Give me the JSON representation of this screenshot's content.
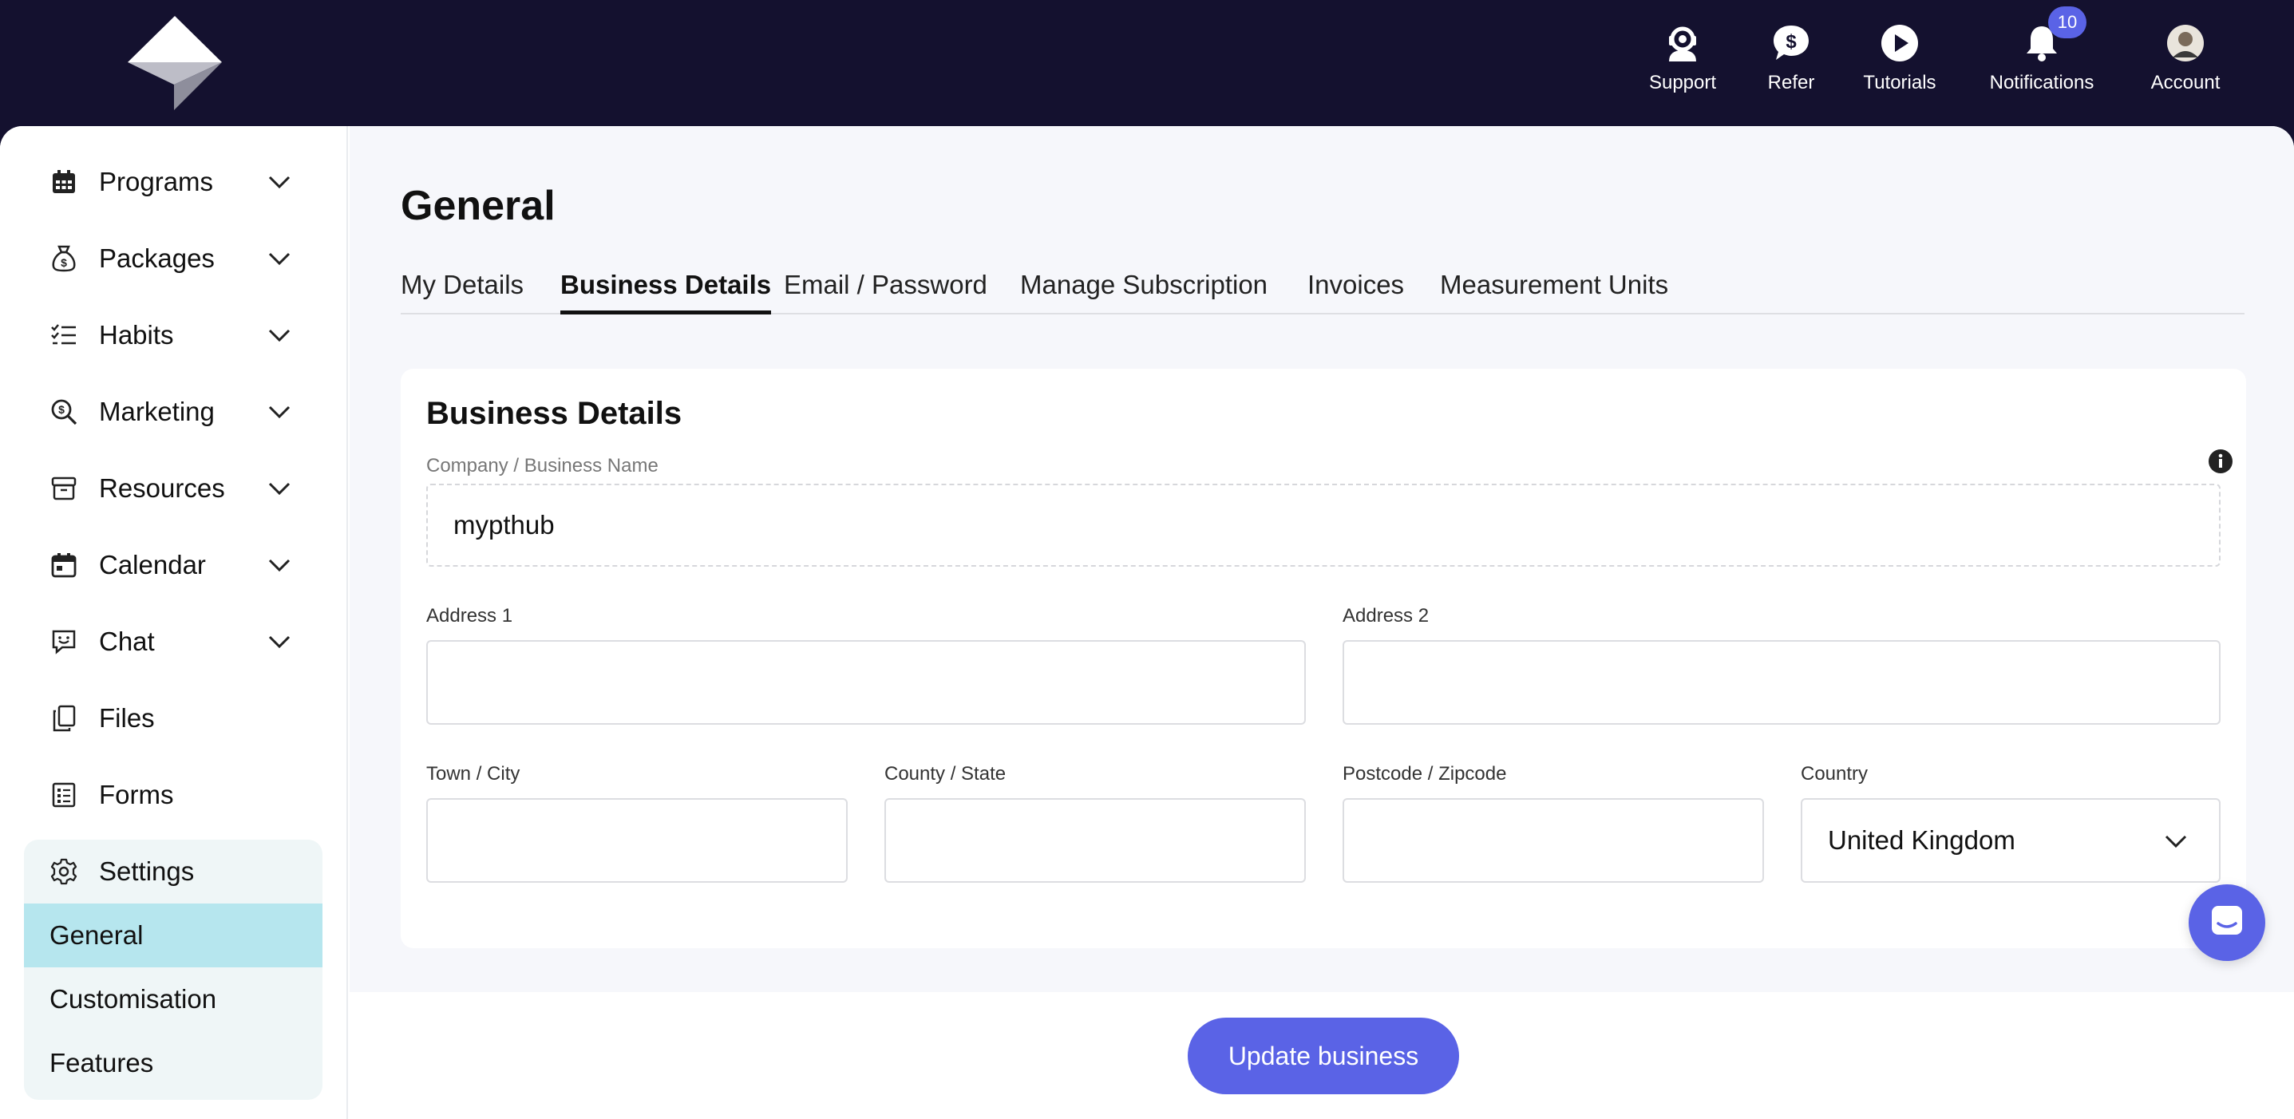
{
  "brand": {
    "logo_icon": "paper-plane-logo"
  },
  "topnav": [
    {
      "label": "Support",
      "icon": "headset-icon"
    },
    {
      "label": "Refer",
      "icon": "dollar-bubble-icon"
    },
    {
      "label": "Tutorials",
      "icon": "play-icon"
    },
    {
      "label": "Notifications",
      "icon": "bell-icon",
      "badge": "10"
    },
    {
      "label": "Account",
      "icon": "avatar"
    }
  ],
  "sidebar": {
    "items": [
      {
        "label": "Programs",
        "icon": "calendar-grid-icon"
      },
      {
        "label": "Packages",
        "icon": "money-bag-icon"
      },
      {
        "label": "Habits",
        "icon": "checklist-icon"
      },
      {
        "label": "Marketing",
        "icon": "search-dollar-icon"
      },
      {
        "label": "Resources",
        "icon": "archive-box-icon"
      },
      {
        "label": "Calendar",
        "icon": "calendar-icon"
      },
      {
        "label": "Chat",
        "icon": "chat-icon"
      },
      {
        "label": "Files",
        "icon": "files-icon"
      },
      {
        "label": "Forms",
        "icon": "form-icon"
      }
    ],
    "settings": {
      "label": "Settings",
      "icon": "gear-icon",
      "sub_items": [
        "General",
        "Customisation",
        "Features"
      ],
      "active": "General"
    }
  },
  "page": {
    "title": "General",
    "tabs": [
      "My Details",
      "Business Details",
      "Email / Password",
      "Manage Subscription",
      "Invoices",
      "Measurement Units"
    ],
    "active_tab": "Business Details"
  },
  "form": {
    "title": "Business Details",
    "company_label": "Company / Business Name",
    "company_value": "mypthub",
    "address1_label": "Address 1",
    "address1_value": "",
    "address2_label": "Address 2",
    "address2_value": "",
    "town_label": "Town / City",
    "town_value": "",
    "county_label": "County / State",
    "county_value": "",
    "postcode_label": "Postcode / Zipcode",
    "postcode_value": "",
    "country_label": "Country",
    "country_value": "United Kingdom",
    "submit_label": "Update business"
  },
  "colors": {
    "topbar": "#14112f",
    "accent": "#5a63e6",
    "active_sub_item": "#b6e6ee",
    "settings_group_bg": "#eff6f7",
    "content_bg": "#f6f7fb"
  }
}
